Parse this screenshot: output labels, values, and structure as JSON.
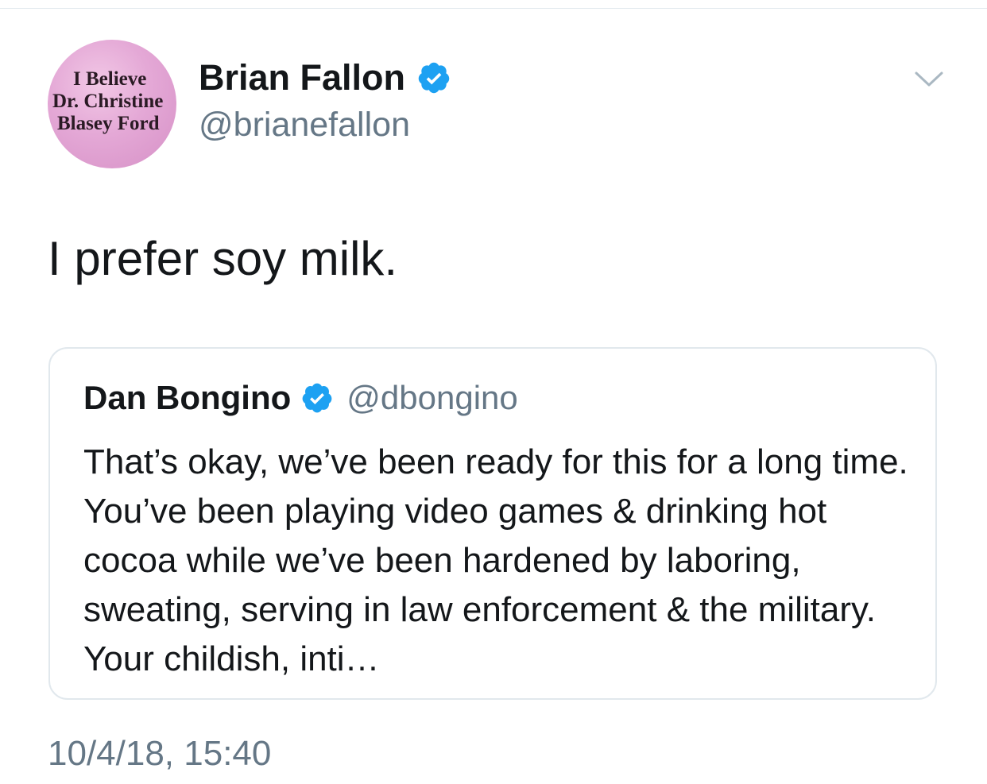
{
  "tweet": {
    "avatar_text": [
      "I Believe",
      "Dr. Christine",
      "Blasey Ford"
    ],
    "avatar_color": "#e4a8d6",
    "display_name": "Brian Fallon",
    "handle": "@brianefallon",
    "verified_icon": "verified-badge-icon",
    "menu_icon": "chevron-down-icon",
    "text": "I prefer soy milk.",
    "timestamp": "10/4/18, 15:40"
  },
  "quoted_tweet": {
    "display_name": "Dan Bongino",
    "handle": "@dbongino",
    "verified_icon": "verified-badge-icon",
    "text": "That’s okay, we’ve been ready for this for a long time. You’ve been playing video games & drinking hot cocoa while we’ve been hardened by laboring, sweating, serving in law enforcement & the military. Your childish, inti…"
  },
  "colors": {
    "verified_blue": "#1da1f2",
    "secondary_text": "#657786",
    "border": "#e1e8ed"
  }
}
